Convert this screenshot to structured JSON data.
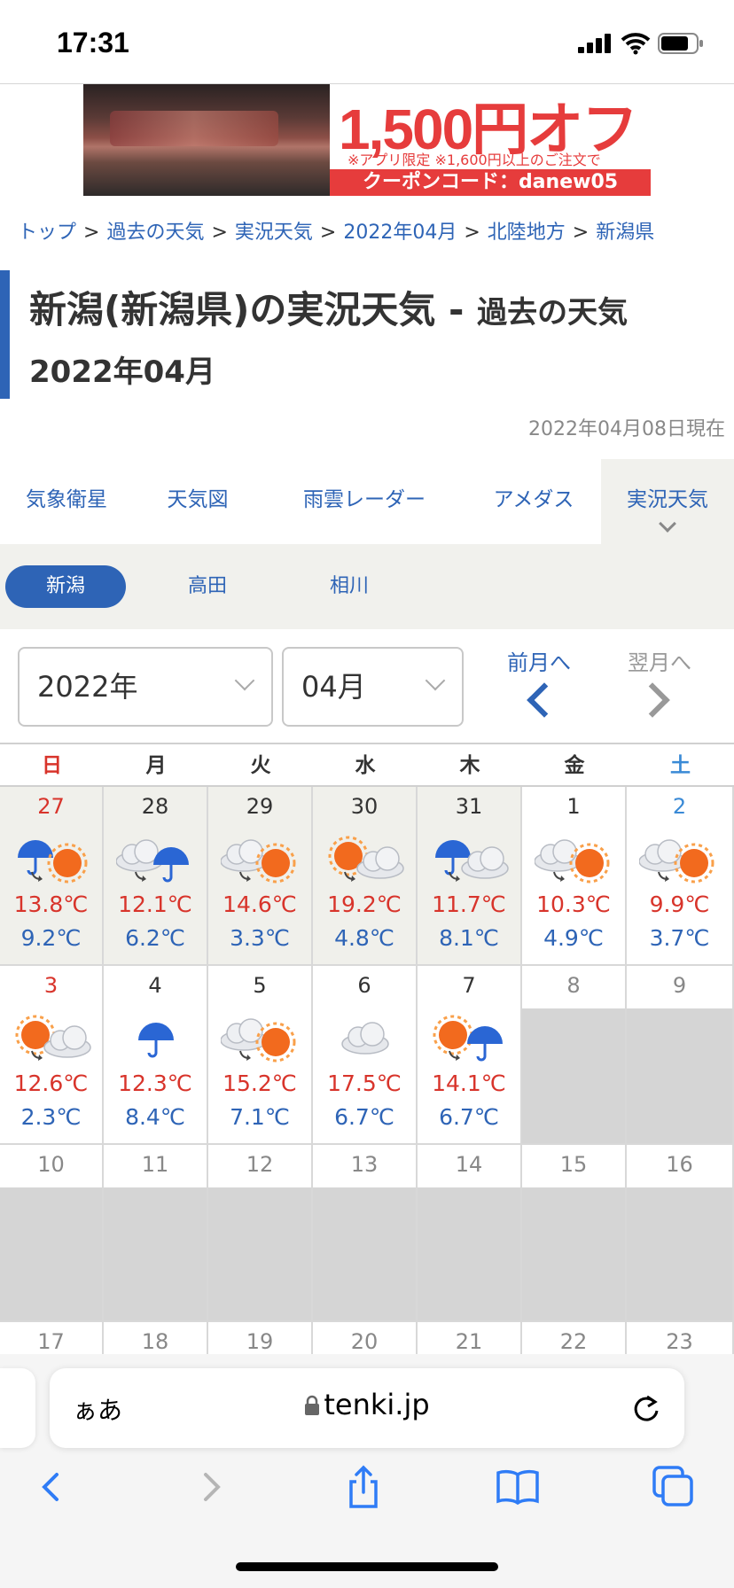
{
  "status_bar": {
    "time": "17:31"
  },
  "ad": {
    "headline": "1,500円オフ",
    "note": "※アプリ限定 ※1,600円以上のご注文で",
    "coupon": "クーポンコード：danew05"
  },
  "breadcrumb": [
    "トップ",
    "過去の天気",
    "実況天気",
    "2022年04月",
    "北陸地方",
    "新潟県"
  ],
  "breadcrumb_sep": ">",
  "title": {
    "main": "新潟(新潟県)の実況天気",
    "dash": " - ",
    "sub": "過去の天気",
    "month": "2022年04月"
  },
  "current_date": "2022年04月08日現在",
  "tabs": [
    "気象衛星",
    "天気図",
    "雨雲レーダー",
    "アメダス",
    "実況天気"
  ],
  "locations": [
    "新潟",
    "高田",
    "相川"
  ],
  "selects": {
    "year": "2022年",
    "month": "04月"
  },
  "nav": {
    "prev": "前月へ",
    "next": "翌月へ"
  },
  "calendar": {
    "weekdays": [
      "日",
      "月",
      "火",
      "水",
      "木",
      "金",
      "土"
    ],
    "weekday_colors": [
      "#d8342b",
      "#333333",
      "#333333",
      "#333333",
      "#333333",
      "#333333",
      "#3a8ad6"
    ],
    "weeks": [
      [
        {
          "day": "27",
          "hi": "13.8℃",
          "lo": "9.2℃",
          "icon": "rain-then-sun-icon",
          "prev": true,
          "day_color": "#d8342b"
        },
        {
          "day": "28",
          "hi": "12.1℃",
          "lo": "6.2℃",
          "icon": "cloud-then-rain-icon",
          "prev": true
        },
        {
          "day": "29",
          "hi": "14.6℃",
          "lo": "3.3℃",
          "icon": "cloud-then-sun-icon",
          "prev": true
        },
        {
          "day": "30",
          "hi": "19.2℃",
          "lo": "4.8℃",
          "icon": "sun-then-cloud-icon",
          "prev": true
        },
        {
          "day": "31",
          "hi": "11.7℃",
          "lo": "8.1℃",
          "icon": "rain-then-cloud-icon",
          "prev": true
        },
        {
          "day": "1",
          "hi": "10.3℃",
          "lo": "4.9℃",
          "icon": "cloud-then-sun-icon"
        },
        {
          "day": "2",
          "hi": "9.9℃",
          "lo": "3.7℃",
          "icon": "cloud-then-sun-icon",
          "day_color": "#3a8ad6"
        }
      ],
      [
        {
          "day": "3",
          "hi": "12.6℃",
          "lo": "2.3℃",
          "icon": "sun-then-cloud-icon",
          "day_color": "#d8342b"
        },
        {
          "day": "4",
          "hi": "12.3℃",
          "lo": "8.4℃",
          "icon": "rain-icon"
        },
        {
          "day": "5",
          "hi": "15.2℃",
          "lo": "7.1℃",
          "icon": "cloud-then-sun-icon"
        },
        {
          "day": "6",
          "hi": "17.5℃",
          "lo": "6.7℃",
          "icon": "cloud-icon"
        },
        {
          "day": "7",
          "hi": "14.1℃",
          "lo": "6.7℃",
          "icon": "sun-then-rain-icon"
        },
        {
          "day": "8",
          "empty": true
        },
        {
          "day": "9",
          "empty": true
        }
      ],
      [
        {
          "day": "10",
          "empty": true
        },
        {
          "day": "11",
          "empty": true
        },
        {
          "day": "12",
          "empty": true
        },
        {
          "day": "13",
          "empty": true
        },
        {
          "day": "14",
          "empty": true
        },
        {
          "day": "15",
          "empty": true
        },
        {
          "day": "16",
          "empty": true
        }
      ],
      [
        {
          "day": "17",
          "empty": true
        },
        {
          "day": "18",
          "empty": true
        },
        {
          "day": "19",
          "empty": true
        },
        {
          "day": "20",
          "empty": true
        },
        {
          "day": "21",
          "empty": true
        },
        {
          "day": "22",
          "empty": true
        },
        {
          "day": "23",
          "empty": true
        }
      ]
    ]
  },
  "browser": {
    "aa": "ぁあ",
    "url": "tenki.jp"
  }
}
